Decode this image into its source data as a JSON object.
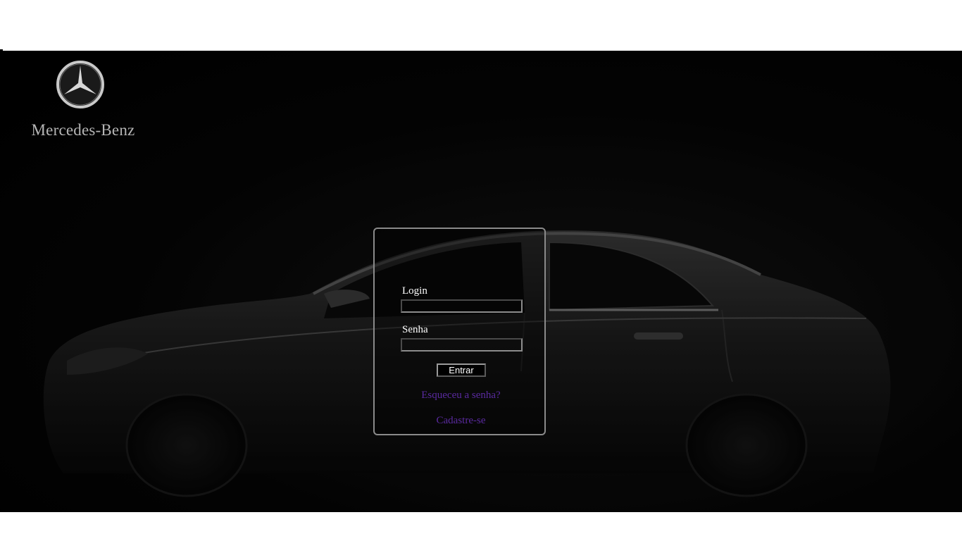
{
  "brand": {
    "logo_icon": "mercedes-star-logo",
    "name": "Mercedes-Benz"
  },
  "login_form": {
    "login_label": "Login",
    "login_value": "",
    "password_label": "Senha",
    "password_value": "",
    "submit_label": "Entrar",
    "forgot_link": "Esqueceu a senha?",
    "register_link": "Cadastre-se"
  },
  "colors": {
    "background": "#000000",
    "brand_text": "#b5b5b5",
    "label_text": "#ffffff",
    "link": "#5a2aa0",
    "box_border": "#8a8a8a"
  }
}
